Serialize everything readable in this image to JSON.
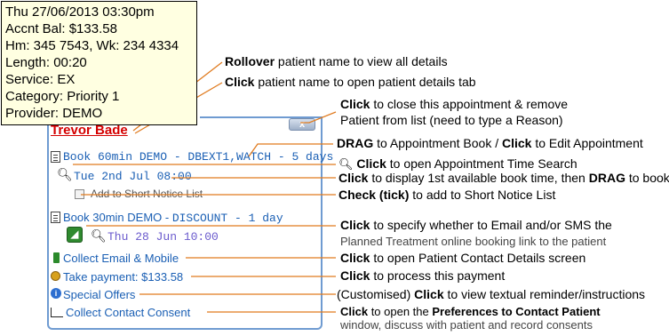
{
  "tooltip": {
    "lines": [
      "Thu 27/06/2013 03:30pm",
      "Accnt Bal: $133.58",
      "Hm: 345 7543, Wk: 234 4334",
      "Length: 00:20",
      "Service: EX",
      "Category: Priority 1",
      "Provider: DEMO"
    ]
  },
  "panel": {
    "patient_name": "Trevor Bade",
    "close_label": "x",
    "appointment1": "Book 60min DEMO - DBEXT1,WATCH - 5 days",
    "next_available": "Tue 2nd Jul 08:00",
    "short_notice": "Add to Short Notice List",
    "appointment2_prefix": "Book 30min DEMO - ",
    "appointment2_suffix": "DISCOUNT - 1 day",
    "booking_date": "Thu 28 Jun 10:00",
    "collect_email": "Collect Email & Mobile",
    "take_payment": "Take payment: $133.58",
    "special_offers": "Special Offers",
    "collect_consent_a": "Collect",
    "collect_consent_b": "Contact Consent",
    "rss_label": "))"
  },
  "annotations": {
    "rollover": [
      "Rollover",
      " patient name to view all details"
    ],
    "click_name": [
      "Click",
      " patient name to open patient details tab"
    ],
    "close": [
      "Click",
      " to close this appointment & remove"
    ],
    "close2": "Patient from list (need to type a Reason)",
    "drag": [
      "DRAG",
      " to Appointment Book / ",
      "Click",
      " to Edit Appointment"
    ],
    "search": [
      "Click",
      " to open Appointment Time Search"
    ],
    "display": [
      "Click",
      " to display 1st available book time, then ",
      "DRAG",
      " to book"
    ],
    "check": [
      "Check (tick)",
      " to add to Short Notice List"
    ],
    "specify": [
      "Click",
      " to specify whether to Email and/or SMS the"
    ],
    "specify2": "Planned Treatment online booking link to the patient",
    "contact": [
      "Click",
      " to open Patient Contact Details screen"
    ],
    "payment": [
      "Click",
      " to process this payment"
    ],
    "offers": [
      "(Customised) ",
      "Click",
      " to view textual reminder/instructions"
    ],
    "prefs": [
      "Click",
      " to open the ",
      "Preferences to Contact Patient"
    ],
    "prefs2": "window, discuss with patient and record consents"
  },
  "colors": {
    "line": "#e07b1f",
    "link": "#1a5fb4",
    "name": "#d40000",
    "panel_border": "#6f9bd1"
  }
}
